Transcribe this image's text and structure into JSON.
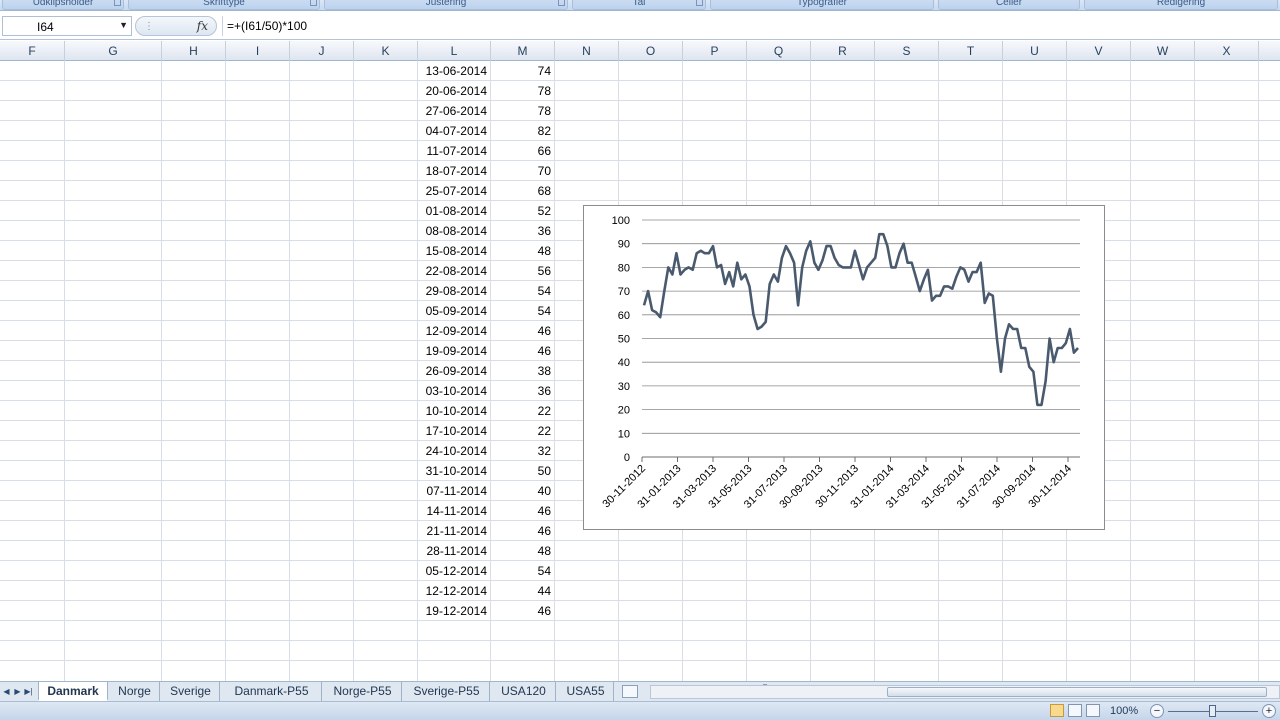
{
  "ribbon": {
    "groups": [
      {
        "label": "Udklipsholder"
      },
      {
        "label": "Skrifttype"
      },
      {
        "label": "Justering"
      },
      {
        "label": "Tal"
      },
      {
        "label": "Typografier"
      },
      {
        "label": "Celler"
      },
      {
        "label": "Redigering"
      }
    ]
  },
  "formula_bar": {
    "name_box": "I64",
    "fx_label": "fx",
    "formula": "=+(I61/50)*100"
  },
  "columns": [
    "F",
    "G",
    "H",
    "I",
    "J",
    "K",
    "L",
    "M",
    "N",
    "O",
    "P",
    "Q",
    "R",
    "S",
    "T",
    "U",
    "V",
    "W",
    "X"
  ],
  "table": {
    "rows": [
      {
        "date": "13-06-2014",
        "value": "74"
      },
      {
        "date": "20-06-2014",
        "value": "78"
      },
      {
        "date": "27-06-2014",
        "value": "78"
      },
      {
        "date": "04-07-2014",
        "value": "82"
      },
      {
        "date": "11-07-2014",
        "value": "66"
      },
      {
        "date": "18-07-2014",
        "value": "70"
      },
      {
        "date": "25-07-2014",
        "value": "68"
      },
      {
        "date": "01-08-2014",
        "value": "52"
      },
      {
        "date": "08-08-2014",
        "value": "36"
      },
      {
        "date": "15-08-2014",
        "value": "48"
      },
      {
        "date": "22-08-2014",
        "value": "56"
      },
      {
        "date": "29-08-2014",
        "value": "54"
      },
      {
        "date": "05-09-2014",
        "value": "54"
      },
      {
        "date": "12-09-2014",
        "value": "46"
      },
      {
        "date": "19-09-2014",
        "value": "46"
      },
      {
        "date": "26-09-2014",
        "value": "38"
      },
      {
        "date": "03-10-2014",
        "value": "36"
      },
      {
        "date": "10-10-2014",
        "value": "22"
      },
      {
        "date": "17-10-2014",
        "value": "22"
      },
      {
        "date": "24-10-2014",
        "value": "32"
      },
      {
        "date": "31-10-2014",
        "value": "50"
      },
      {
        "date": "07-11-2014",
        "value": "40"
      },
      {
        "date": "14-11-2014",
        "value": "46"
      },
      {
        "date": "21-11-2014",
        "value": "46"
      },
      {
        "date": "28-11-2014",
        "value": "48"
      },
      {
        "date": "05-12-2014",
        "value": "54"
      },
      {
        "date": "12-12-2014",
        "value": "44"
      },
      {
        "date": "19-12-2014",
        "value": "46"
      }
    ]
  },
  "chart_data": {
    "type": "line",
    "title": "",
    "xlabel": "",
    "ylabel": "",
    "ylim": [
      0,
      100
    ],
    "yticks": [
      0,
      10,
      20,
      30,
      40,
      50,
      60,
      70,
      80,
      90,
      100
    ],
    "xticks": [
      "30-11-2012",
      "31-01-2013",
      "31-03-2013",
      "31-05-2013",
      "31-07-2013",
      "30-09-2013",
      "30-11-2013",
      "31-01-2014",
      "31-03-2014",
      "31-05-2014",
      "31-07-2014",
      "30-09-2014",
      "30-11-2014"
    ],
    "grid": "horizontal",
    "line_color": "#4a5a6e",
    "series": [
      {
        "values": [
          64,
          70,
          62,
          61,
          59,
          70,
          80,
          77,
          86,
          77,
          79,
          80,
          79,
          86,
          87,
          86,
          86,
          89,
          80,
          81,
          73,
          78,
          72,
          82,
          75,
          77,
          72,
          60,
          54,
          55,
          57,
          73,
          77,
          74,
          84,
          89,
          86,
          82,
          64,
          80,
          87,
          91,
          82,
          79,
          83,
          89,
          89,
          84,
          81,
          80,
          80,
          80,
          87,
          81,
          75,
          80,
          82,
          84,
          94,
          94,
          89,
          80,
          80,
          86,
          90,
          82,
          82,
          76,
          70,
          75,
          79,
          66,
          68,
          68,
          72,
          72,
          71,
          76,
          80,
          79,
          74,
          78,
          78,
          82,
          65,
          69,
          68,
          50,
          36,
          50,
          56,
          54,
          54,
          46,
          46,
          38,
          36,
          22,
          22,
          32,
          50,
          40,
          46,
          46,
          48,
          54,
          44,
          46
        ]
      }
    ]
  },
  "sheet_tabs": [
    {
      "label": "Danmark",
      "active": true
    },
    {
      "label": "Norge",
      "active": false
    },
    {
      "label": "Sverige",
      "active": false
    },
    {
      "label": "Danmark-P55",
      "active": false
    },
    {
      "label": "Norge-P55",
      "active": false
    },
    {
      "label": "Sverige-P55",
      "active": false
    },
    {
      "label": "USA120",
      "active": false
    },
    {
      "label": "USA55",
      "active": false
    }
  ],
  "status_bar": {
    "zoom": "100%"
  }
}
